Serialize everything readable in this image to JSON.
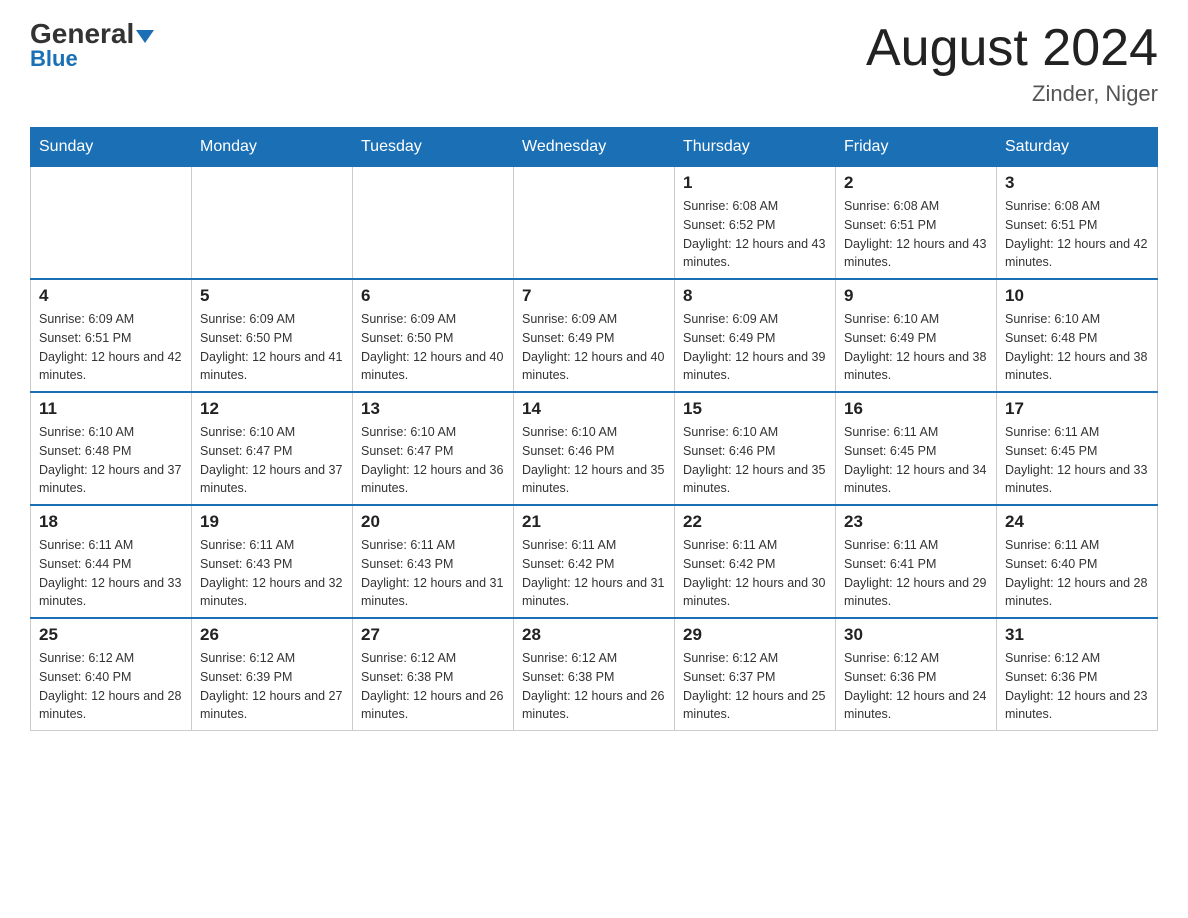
{
  "header": {
    "logo_general": "General",
    "logo_blue": "Blue",
    "month_title": "August 2024",
    "location": "Zinder, Niger"
  },
  "days_of_week": [
    "Sunday",
    "Monday",
    "Tuesday",
    "Wednesday",
    "Thursday",
    "Friday",
    "Saturday"
  ],
  "weeks": [
    [
      {
        "day": "",
        "info": ""
      },
      {
        "day": "",
        "info": ""
      },
      {
        "day": "",
        "info": ""
      },
      {
        "day": "",
        "info": ""
      },
      {
        "day": "1",
        "info": "Sunrise: 6:08 AM\nSunset: 6:52 PM\nDaylight: 12 hours and 43 minutes."
      },
      {
        "day": "2",
        "info": "Sunrise: 6:08 AM\nSunset: 6:51 PM\nDaylight: 12 hours and 43 minutes."
      },
      {
        "day": "3",
        "info": "Sunrise: 6:08 AM\nSunset: 6:51 PM\nDaylight: 12 hours and 42 minutes."
      }
    ],
    [
      {
        "day": "4",
        "info": "Sunrise: 6:09 AM\nSunset: 6:51 PM\nDaylight: 12 hours and 42 minutes."
      },
      {
        "day": "5",
        "info": "Sunrise: 6:09 AM\nSunset: 6:50 PM\nDaylight: 12 hours and 41 minutes."
      },
      {
        "day": "6",
        "info": "Sunrise: 6:09 AM\nSunset: 6:50 PM\nDaylight: 12 hours and 40 minutes."
      },
      {
        "day": "7",
        "info": "Sunrise: 6:09 AM\nSunset: 6:49 PM\nDaylight: 12 hours and 40 minutes."
      },
      {
        "day": "8",
        "info": "Sunrise: 6:09 AM\nSunset: 6:49 PM\nDaylight: 12 hours and 39 minutes."
      },
      {
        "day": "9",
        "info": "Sunrise: 6:10 AM\nSunset: 6:49 PM\nDaylight: 12 hours and 38 minutes."
      },
      {
        "day": "10",
        "info": "Sunrise: 6:10 AM\nSunset: 6:48 PM\nDaylight: 12 hours and 38 minutes."
      }
    ],
    [
      {
        "day": "11",
        "info": "Sunrise: 6:10 AM\nSunset: 6:48 PM\nDaylight: 12 hours and 37 minutes."
      },
      {
        "day": "12",
        "info": "Sunrise: 6:10 AM\nSunset: 6:47 PM\nDaylight: 12 hours and 37 minutes."
      },
      {
        "day": "13",
        "info": "Sunrise: 6:10 AM\nSunset: 6:47 PM\nDaylight: 12 hours and 36 minutes."
      },
      {
        "day": "14",
        "info": "Sunrise: 6:10 AM\nSunset: 6:46 PM\nDaylight: 12 hours and 35 minutes."
      },
      {
        "day": "15",
        "info": "Sunrise: 6:10 AM\nSunset: 6:46 PM\nDaylight: 12 hours and 35 minutes."
      },
      {
        "day": "16",
        "info": "Sunrise: 6:11 AM\nSunset: 6:45 PM\nDaylight: 12 hours and 34 minutes."
      },
      {
        "day": "17",
        "info": "Sunrise: 6:11 AM\nSunset: 6:45 PM\nDaylight: 12 hours and 33 minutes."
      }
    ],
    [
      {
        "day": "18",
        "info": "Sunrise: 6:11 AM\nSunset: 6:44 PM\nDaylight: 12 hours and 33 minutes."
      },
      {
        "day": "19",
        "info": "Sunrise: 6:11 AM\nSunset: 6:43 PM\nDaylight: 12 hours and 32 minutes."
      },
      {
        "day": "20",
        "info": "Sunrise: 6:11 AM\nSunset: 6:43 PM\nDaylight: 12 hours and 31 minutes."
      },
      {
        "day": "21",
        "info": "Sunrise: 6:11 AM\nSunset: 6:42 PM\nDaylight: 12 hours and 31 minutes."
      },
      {
        "day": "22",
        "info": "Sunrise: 6:11 AM\nSunset: 6:42 PM\nDaylight: 12 hours and 30 minutes."
      },
      {
        "day": "23",
        "info": "Sunrise: 6:11 AM\nSunset: 6:41 PM\nDaylight: 12 hours and 29 minutes."
      },
      {
        "day": "24",
        "info": "Sunrise: 6:11 AM\nSunset: 6:40 PM\nDaylight: 12 hours and 28 minutes."
      }
    ],
    [
      {
        "day": "25",
        "info": "Sunrise: 6:12 AM\nSunset: 6:40 PM\nDaylight: 12 hours and 28 minutes."
      },
      {
        "day": "26",
        "info": "Sunrise: 6:12 AM\nSunset: 6:39 PM\nDaylight: 12 hours and 27 minutes."
      },
      {
        "day": "27",
        "info": "Sunrise: 6:12 AM\nSunset: 6:38 PM\nDaylight: 12 hours and 26 minutes."
      },
      {
        "day": "28",
        "info": "Sunrise: 6:12 AM\nSunset: 6:38 PM\nDaylight: 12 hours and 26 minutes."
      },
      {
        "day": "29",
        "info": "Sunrise: 6:12 AM\nSunset: 6:37 PM\nDaylight: 12 hours and 25 minutes."
      },
      {
        "day": "30",
        "info": "Sunrise: 6:12 AM\nSunset: 6:36 PM\nDaylight: 12 hours and 24 minutes."
      },
      {
        "day": "31",
        "info": "Sunrise: 6:12 AM\nSunset: 6:36 PM\nDaylight: 12 hours and 23 minutes."
      }
    ]
  ]
}
